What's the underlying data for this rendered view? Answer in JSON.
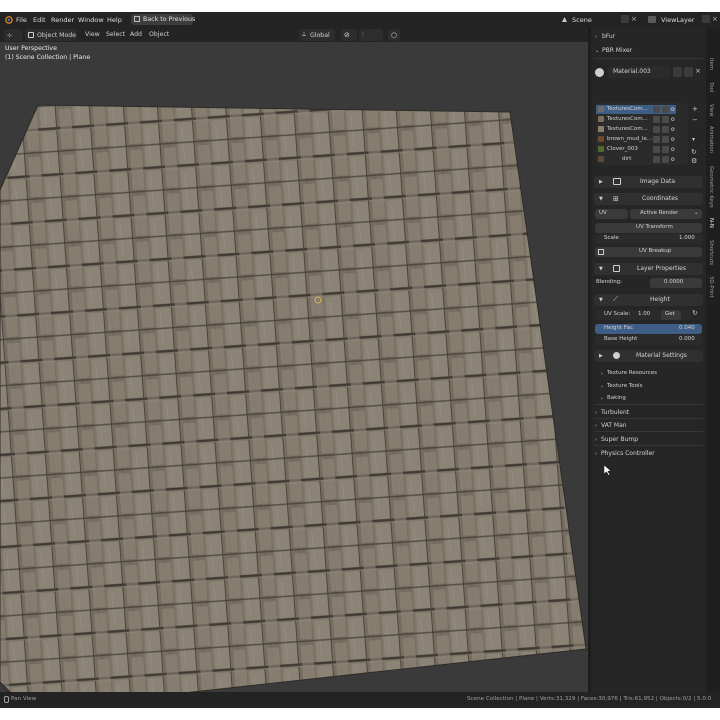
{
  "menubar": {
    "items": [
      "File",
      "Edit",
      "Render",
      "Window",
      "Help"
    ],
    "back_button": "Back to Previous",
    "scene_label": "Scene",
    "viewlayer_label": "ViewLayer"
  },
  "viewport_header": {
    "mode": "Object Mode",
    "menus": [
      "View",
      "Select",
      "Add",
      "Object"
    ],
    "orientation": "Global"
  },
  "viewport": {
    "perspective": "User Perspective",
    "collection": "(1) Scene Collection | Plane"
  },
  "sidebar": {
    "tabs": [
      "Item",
      "Tool",
      "View",
      "Animation",
      "Geometric Keys",
      "N-N",
      "Shortcuts",
      "3D-Print"
    ],
    "active_tab": "N-N"
  },
  "properties": {
    "addon_bfur": "bFur",
    "addon_pbr": "PBR Mixer",
    "material_name": "Material.003",
    "layers": [
      {
        "name": "TexturesCom...",
        "color": "#6a6a6a"
      },
      {
        "name": "TexturesCom...",
        "color": "#7a6e5a"
      },
      {
        "name": "TexturesCom...",
        "color": "#8a8070"
      },
      {
        "name": "brown_mud_le...",
        "color": "#6a4a2a"
      },
      {
        "name": "Clover_003",
        "color": "#4e6a2e"
      },
      {
        "name": "dirt",
        "color": "#5a4a3a"
      }
    ],
    "image_data": "Image Data",
    "coordinates": {
      "title": "Coordinates",
      "mapping": "UV",
      "render_mode": "Active Render",
      "uv_transform": "UV Transform",
      "scale_label": "Scale",
      "scale_value": "1.000",
      "uv_breakup": "UV Breakup"
    },
    "layer_properties": {
      "title": "Layer Properties",
      "blending_label": "Blending:",
      "blending_value": "0.0000"
    },
    "height": {
      "title": "Height",
      "uv_scale_label": "UV Scale:",
      "uv_scale_value": "1.00",
      "get_button": "Get",
      "height_fac_label": "Height Fac",
      "height_fac_value": "0.040",
      "base_height_label": "Base Height",
      "base_height_value": "0.000"
    },
    "material_settings": {
      "title": "Material Settings",
      "items": [
        "Texture Resources",
        "Texture Tools",
        "Baking"
      ]
    },
    "addons": [
      "Turbulent",
      "VAT Man",
      "Super Bump",
      "Physics Controller"
    ]
  },
  "statusbar": {
    "left": "Pan View",
    "stats": "Scene Collection | Plane | Verts:31,329 | Faces:30,976 | Tris:61,952 | Objects:0/2 | 5.0.0"
  },
  "colors": {
    "accent": "#4772b3",
    "panel_bg": "#262626",
    "header_bg": "#232323"
  }
}
